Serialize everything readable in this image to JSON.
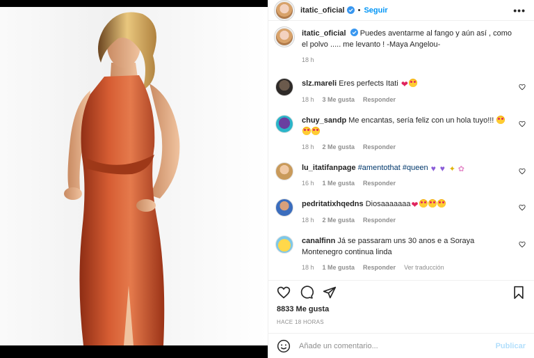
{
  "post": {
    "author": "itatic_oficial",
    "follow_label": "Seguir",
    "more_label": "•••",
    "caption_user": "itatic_oficial",
    "caption_text": "Puedes aventarme al fango y aún así , como el polvo ..... me levanto ! -Maya Angelou-",
    "caption_time": "18 h",
    "likes": "8833 Me gusta",
    "timestamp": "HACE 18 HORAS",
    "comment_placeholder": "Añade un comentario...",
    "publish_label": "Publicar"
  },
  "comments": [
    {
      "user": "slz.mareli",
      "text": "Eres perfects Itati",
      "time": "18 h",
      "likes": "3 Me gusta",
      "reply": "Responder"
    },
    {
      "user": "chuy_sandp",
      "text": "Me encantas, sería feliz con un hola tuyo!!!",
      "time": "18 h",
      "likes": "2 Me gusta",
      "reply": "Responder"
    },
    {
      "user": "lu_itatifanpage",
      "hashtag1": "#amentothat",
      "hashtag2": "#queen",
      "time": "16 h",
      "likes": "1 Me gusta",
      "reply": "Responder"
    },
    {
      "user": "pedritatixhqedns",
      "text": "Diosaaaaaaa",
      "time": "18 h",
      "likes": "2 Me gusta",
      "reply": "Responder"
    },
    {
      "user": "canalfinn",
      "text": "Já se passaram uns 30 anos e a Soraya Montenegro continua linda",
      "time": "18 h",
      "likes": "1 Me gusta",
      "reply": "Responder",
      "translate": "Ver traducción"
    }
  ],
  "icons": {
    "more": "more-icon",
    "verified": "verified-badge-icon",
    "like": "heart-icon",
    "comment": "comment-icon",
    "share": "share-icon",
    "save": "bookmark-icon",
    "emoji": "emoji-icon"
  },
  "colors": {
    "accent": "#0095f6",
    "dress": "#c8502a",
    "verified": "#3897f0"
  }
}
